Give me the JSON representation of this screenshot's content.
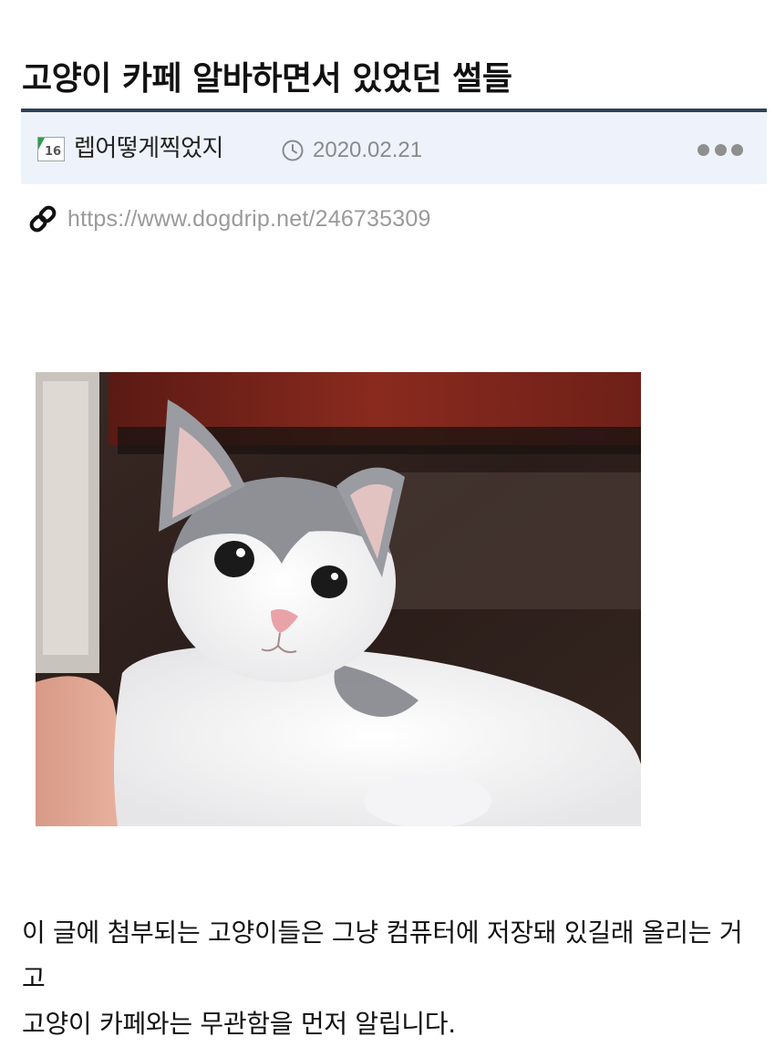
{
  "post": {
    "title": "고양이 카페 알바하면서 있었던 썰들",
    "author": "렙어떻게찍었지",
    "level_badge_text": "16",
    "date": "2020.02.21",
    "url": "https://www.dogdrip.net/246735309",
    "paragraphs": [
      "이 글에 첨부되는 고양이들은 그냥 컴퓨터에 저장돼 있길래 올리는 거고",
      "고양이 카페와는 무관함을 먼저 알립니다."
    ]
  },
  "icons": {
    "level_badge": "level-badge-icon",
    "clock": "clock-icon",
    "more": "more-dots-icon",
    "link": "link-icon"
  },
  "colors": {
    "header_border": "#2f4257",
    "meta_background": "#eef3fb",
    "muted_text": "#8a8a8a",
    "badge_green": "#2e9e4a"
  }
}
